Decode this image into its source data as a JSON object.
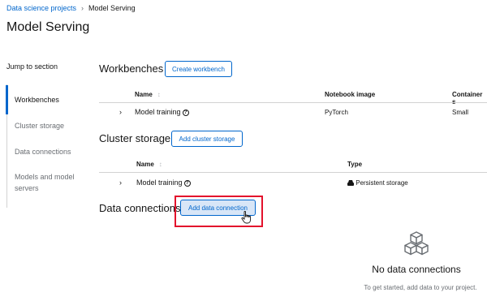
{
  "breadcrumb": {
    "parent": "Data science projects",
    "separator": "›",
    "current": "Model Serving"
  },
  "page": {
    "title": "Model Serving"
  },
  "jump": {
    "label": "Jump to section"
  },
  "nav": {
    "items": [
      {
        "label": "Workbenches",
        "active": true
      },
      {
        "label": "Cluster storage"
      },
      {
        "label": "Data connections"
      },
      {
        "label": "Models and model servers"
      }
    ]
  },
  "workbenches": {
    "title": "Workbenches",
    "button": "Create workbench",
    "columns": [
      "Name",
      "Notebook image",
      "Container s"
    ],
    "rows": [
      {
        "name": "Model training",
        "image": "PyTorch",
        "size": "Small"
      }
    ]
  },
  "storage": {
    "title": "Cluster storage",
    "button": "Add cluster storage",
    "columns": [
      "Name",
      "Type"
    ],
    "rows": [
      {
        "name": "Model training",
        "type": "Persistent storage"
      }
    ]
  },
  "connections": {
    "title": "Data connections",
    "button": "Add data connection",
    "empty_title": "No data connections",
    "empty_body": "To get started, add data to your project."
  },
  "colors": {
    "accent": "#0066cc",
    "highlight": "#e3122c"
  },
  "icons": {
    "sort": "sort-icon",
    "chevron": "chevron-right-icon",
    "help": "help-circle-icon",
    "storage": "storage-icon",
    "cubes": "cubes-icon",
    "cursor": "hand-pointer-icon"
  }
}
